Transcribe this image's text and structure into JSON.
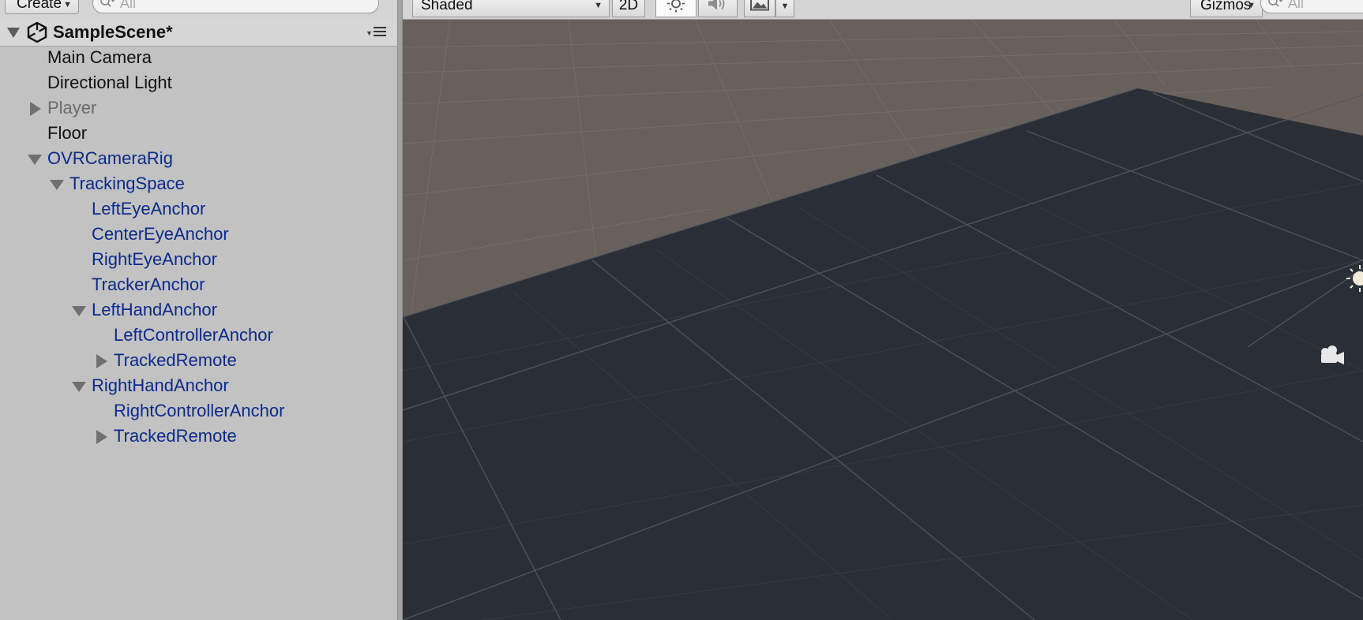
{
  "hierarchy": {
    "create_label": "Create",
    "search_placeholder": "All",
    "scene_name": "SampleScene*",
    "items": [
      {
        "label": "Main Camera",
        "color": "#111111",
        "foldout": "none"
      },
      {
        "label": "Directional Light",
        "color": "#111111",
        "foldout": "none"
      },
      {
        "label": "Player",
        "color": "#6b6b6b",
        "foldout": "collapsed"
      },
      {
        "label": "Floor",
        "color": "#111111",
        "foldout": "none"
      },
      {
        "label": "OVRCameraRig",
        "color": "#0c2a8a",
        "foldout": "expanded"
      },
      {
        "label": "TrackingSpace",
        "color": "#0c2a8a",
        "foldout": "expanded"
      },
      {
        "label": "LeftEyeAnchor",
        "color": "#0c2a8a",
        "foldout": "none"
      },
      {
        "label": "CenterEyeAnchor",
        "color": "#0c2a8a",
        "foldout": "none"
      },
      {
        "label": "RightEyeAnchor",
        "color": "#0c2a8a",
        "foldout": "none"
      },
      {
        "label": "TrackerAnchor",
        "color": "#0c2a8a",
        "foldout": "none"
      },
      {
        "label": "LeftHandAnchor",
        "color": "#0c2a8a",
        "foldout": "expanded"
      },
      {
        "label": "LeftControllerAnchor",
        "color": "#0c2a8a",
        "foldout": "none"
      },
      {
        "label": "TrackedRemote",
        "color": "#0c2a8a",
        "foldout": "collapsed"
      },
      {
        "label": "RightHandAnchor",
        "color": "#0c2a8a",
        "foldout": "expanded"
      },
      {
        "label": "RightControllerAnchor",
        "color": "#0c2a8a",
        "foldout": "none"
      },
      {
        "label": "TrackedRemote",
        "color": "#0c2a8a",
        "foldout": "collapsed"
      }
    ]
  },
  "scene_view": {
    "draw_mode_label": "Shaded",
    "toggle_2d_label": "2D",
    "lighting_icon": "sun-icon",
    "audio_icon": "speaker-icon",
    "effects_icon": "image-icon",
    "gizmos_label": "Gizmos",
    "search_placeholder": "All",
    "ground_color": "#6a605b",
    "floor_color": "#2a2f37",
    "sky_color": "#24282e"
  }
}
